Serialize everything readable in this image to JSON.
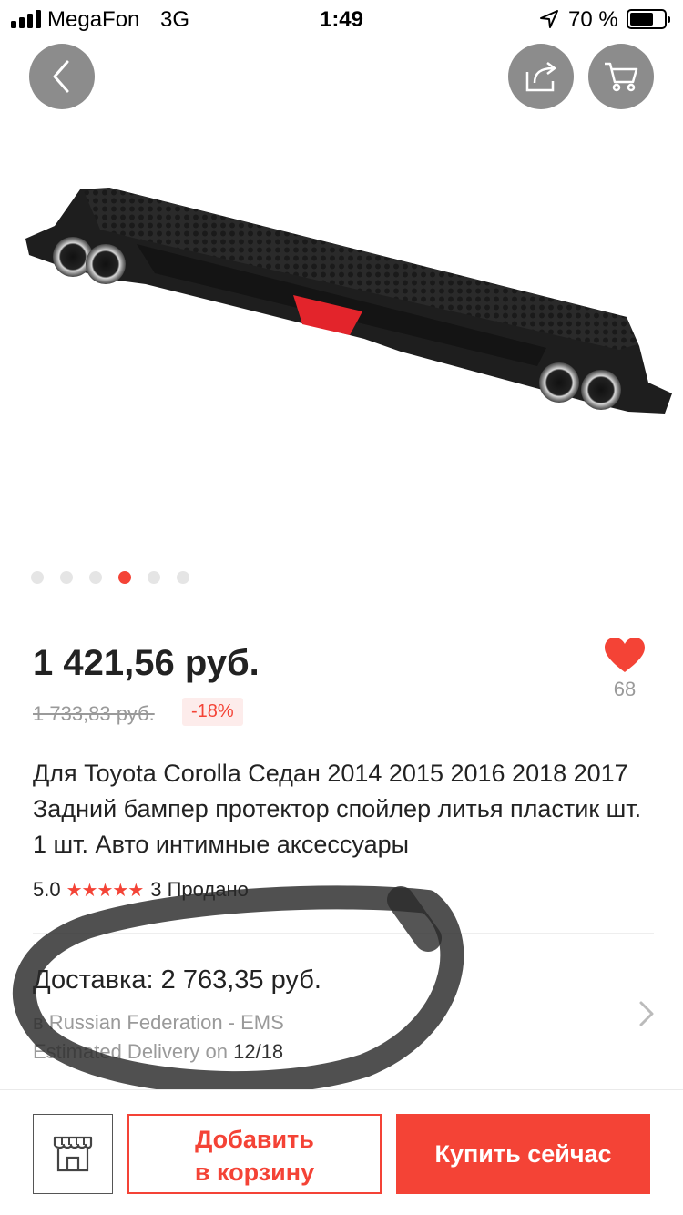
{
  "status_bar": {
    "carrier": "MegaFon",
    "network": "3G",
    "time": "1:49",
    "battery_percent": "70 %",
    "battery_level": 0.7
  },
  "header": {
    "back_icon": "chevron-left-icon",
    "share_icon": "share-icon",
    "cart_icon": "cart-icon"
  },
  "gallery": {
    "image_icon": "rear-bumper-diffuser-photo",
    "dot_count": 6,
    "active_index": 3
  },
  "product": {
    "price": "1 421,56 руб.",
    "old_price": "1 733,83 руб.",
    "discount": "-18%",
    "wishlist_count": "68",
    "title": "Для Toyota Corolla Седан 2014 2015 2016 2018 2017 Задний бампер протектор спойлер литья пластик шт. 1 шт. Авто интимные аксессуары",
    "rating": "5.0",
    "stars": "★★★★★",
    "sold": "3 Продано"
  },
  "shipping": {
    "cost": "Доставка: 2 763,35 руб.",
    "from": "в Russian Federation - EMS",
    "estimated_label": "Estimated Delivery on",
    "estimated_date": "12/18"
  },
  "actions": {
    "add_to_cart_line1": "Добавить",
    "add_to_cart_line2": "в корзину",
    "buy_now": "Купить сейчас"
  },
  "colors": {
    "accent": "#f44336",
    "muted": "#9a9a9a",
    "overlay_button": "#787878"
  }
}
